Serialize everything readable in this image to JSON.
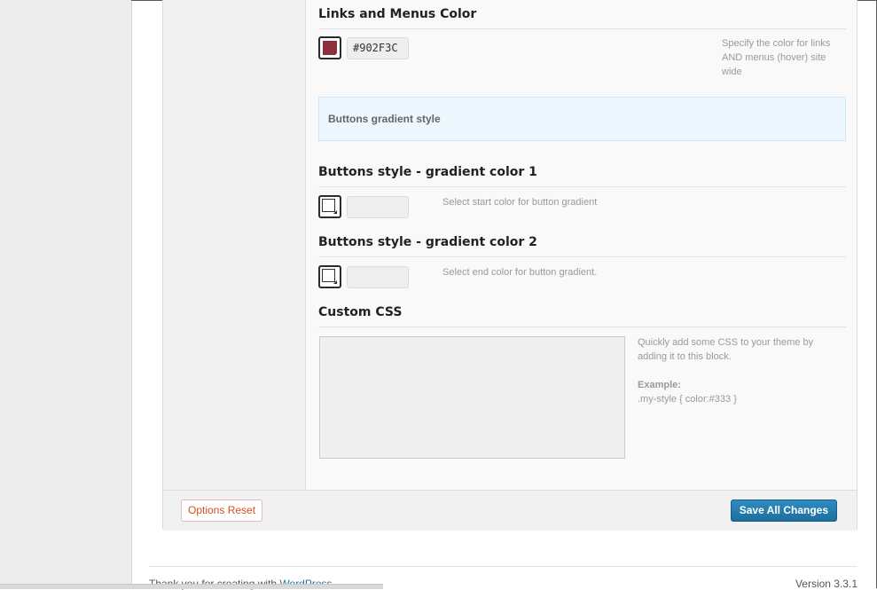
{
  "links_menus": {
    "heading": "Links and Menus Color",
    "color_value": "#902F3C",
    "swatch_color": "#902F3C",
    "hint": "Specify the color for links AND menus (hover) site wide"
  },
  "buttons_gradient_info": {
    "title": "Buttons gradient style"
  },
  "gradient_color_1": {
    "heading": "Buttons style - gradient color 1",
    "color_value": "",
    "hint": "Select start color for button gradient"
  },
  "gradient_color_2": {
    "heading": "Buttons style - gradient color 2",
    "color_value": "",
    "hint": "Select end color for button gradient."
  },
  "custom_css": {
    "heading": "Custom CSS",
    "value": "",
    "hint_line1": "Quickly add some CSS to your theme by adding it to this block.",
    "example_label": "Example:",
    "example_code": ".my-style { color:#333 }"
  },
  "footer": {
    "reset_label": "Options Reset",
    "save_label": "Save All Changes"
  },
  "wp_footer": {
    "thanks_prefix": "Thank you for creating with ",
    "wordpress_link": "WordPress",
    "thanks_suffix": ".",
    "version": "Version 3.3.1"
  },
  "colors": {
    "accent_blue": "#21759B",
    "reset_red": "#D54E21"
  }
}
